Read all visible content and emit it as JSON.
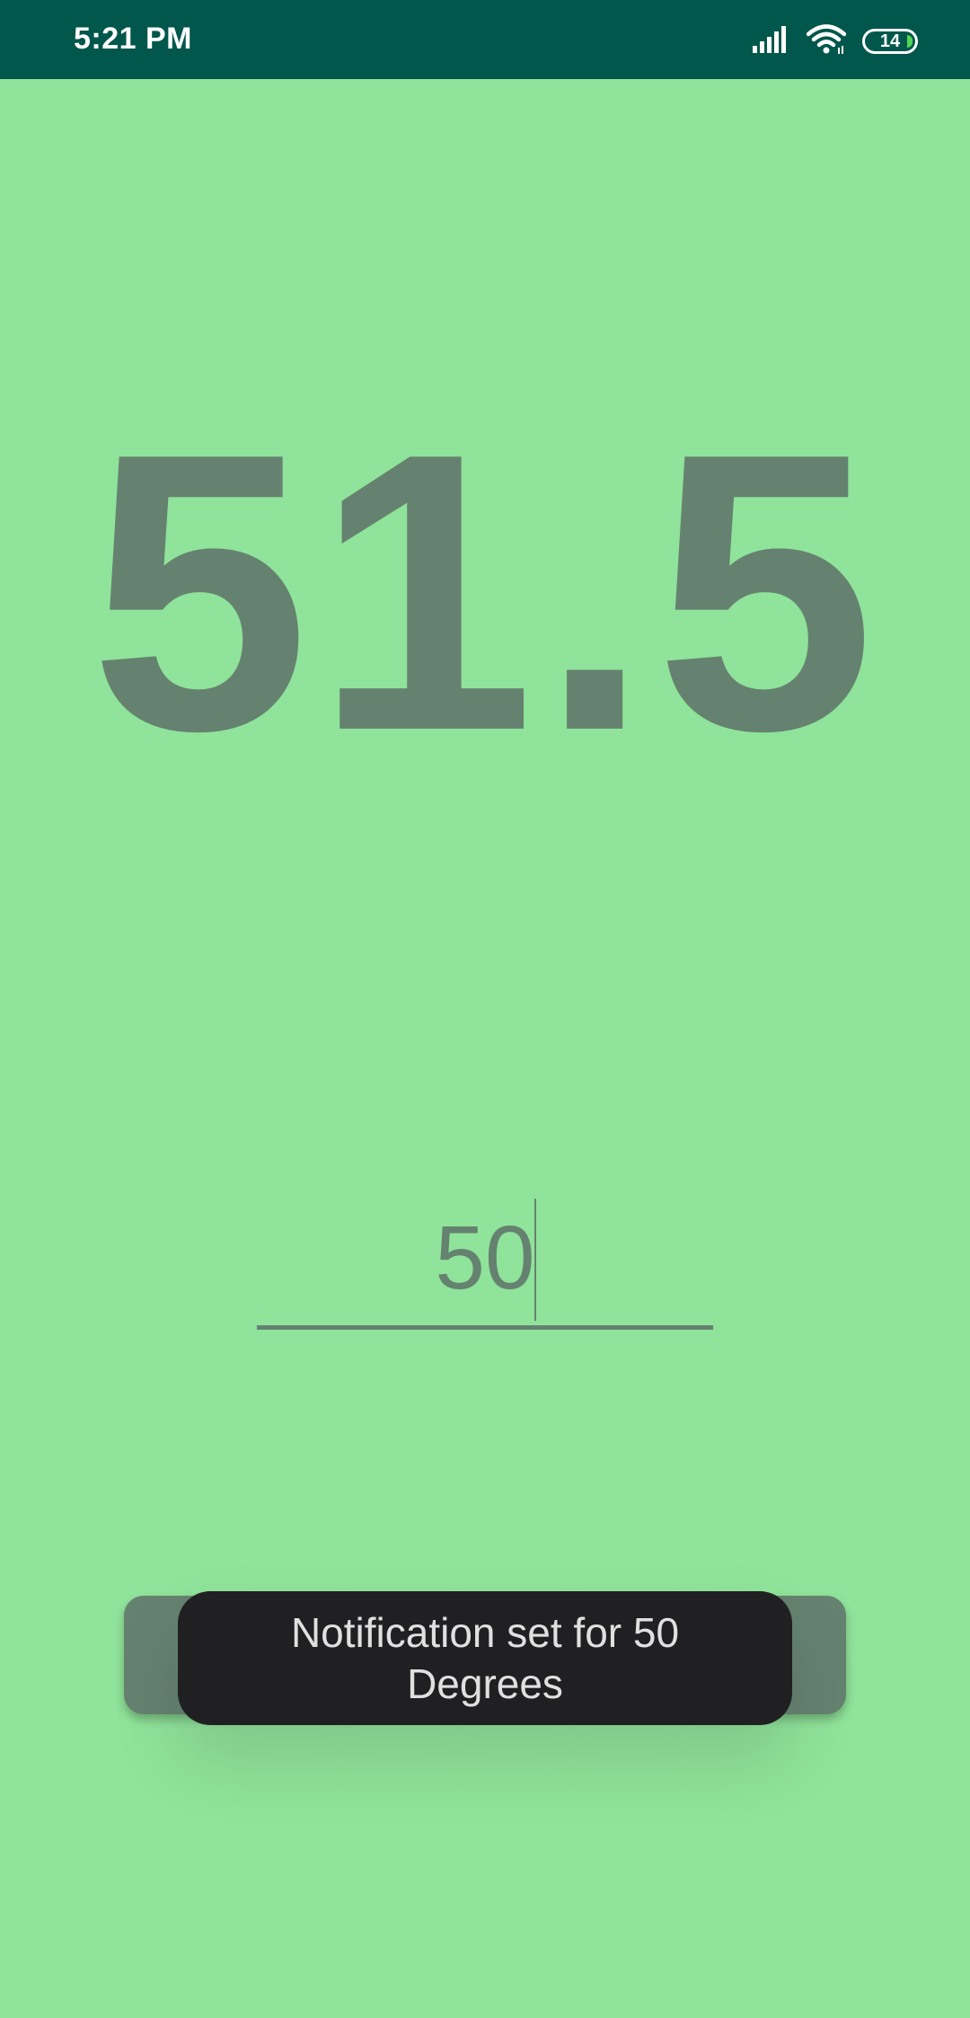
{
  "status_bar": {
    "time": "5:21 PM",
    "icons": [
      "signal-icon",
      "wifi-icon",
      "battery-icon"
    ],
    "battery_level": "14",
    "background_color": "#02574c"
  },
  "main": {
    "reading": "51.5",
    "threshold_input": {
      "value": "50"
    },
    "background_color": "#90e39a",
    "accent_color": "#658270"
  },
  "toast": {
    "message": "Notification set for 50 Degrees"
  }
}
